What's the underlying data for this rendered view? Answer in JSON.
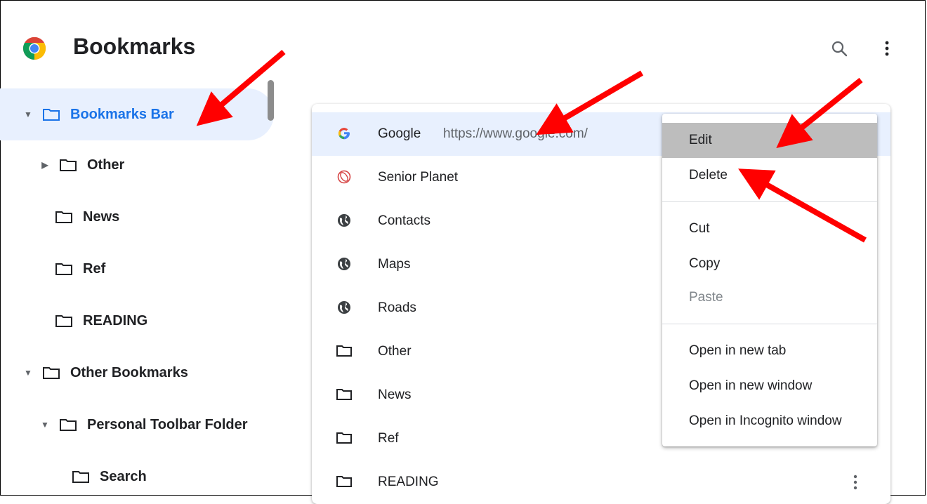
{
  "header": {
    "title": "Bookmarks"
  },
  "sidebar": {
    "items": [
      {
        "label": "Bookmarks Bar",
        "expanded": true,
        "selected": true
      },
      {
        "label": "Other",
        "collapsed": true
      },
      {
        "label": "News"
      },
      {
        "label": "Ref"
      },
      {
        "label": "READING"
      },
      {
        "label": "Other Bookmarks",
        "expanded": true
      },
      {
        "label": "Personal Toolbar Folder",
        "expanded": true
      },
      {
        "label": "Search"
      }
    ]
  },
  "list": {
    "rows": [
      {
        "name": "Google",
        "url": "https://www.google.com/",
        "icon": "google-icon"
      },
      {
        "name": "Senior Planet",
        "icon": "senior-planet-icon"
      },
      {
        "name": "Contacts",
        "icon": "globe-icon"
      },
      {
        "name": "Maps",
        "icon": "globe-icon"
      },
      {
        "name": "Roads",
        "icon": "globe-icon"
      },
      {
        "name": "Other",
        "icon": "folder-icon"
      },
      {
        "name": "News",
        "icon": "folder-icon"
      },
      {
        "name": "Ref",
        "icon": "folder-icon"
      },
      {
        "name": "READING",
        "icon": "folder-icon"
      }
    ]
  },
  "context_menu": {
    "edit": "Edit",
    "delete": "Delete",
    "cut": "Cut",
    "copy": "Copy",
    "paste": "Paste",
    "open_new_tab": "Open in new tab",
    "open_new_window": "Open in new window",
    "open_incognito": "Open in Incognito window"
  },
  "colors": {
    "accent": "#1a73e8",
    "selected_bg": "#e8f0fe",
    "annotation_arrow": "#ff0000",
    "menu_highlight": "#bdbdbd"
  }
}
